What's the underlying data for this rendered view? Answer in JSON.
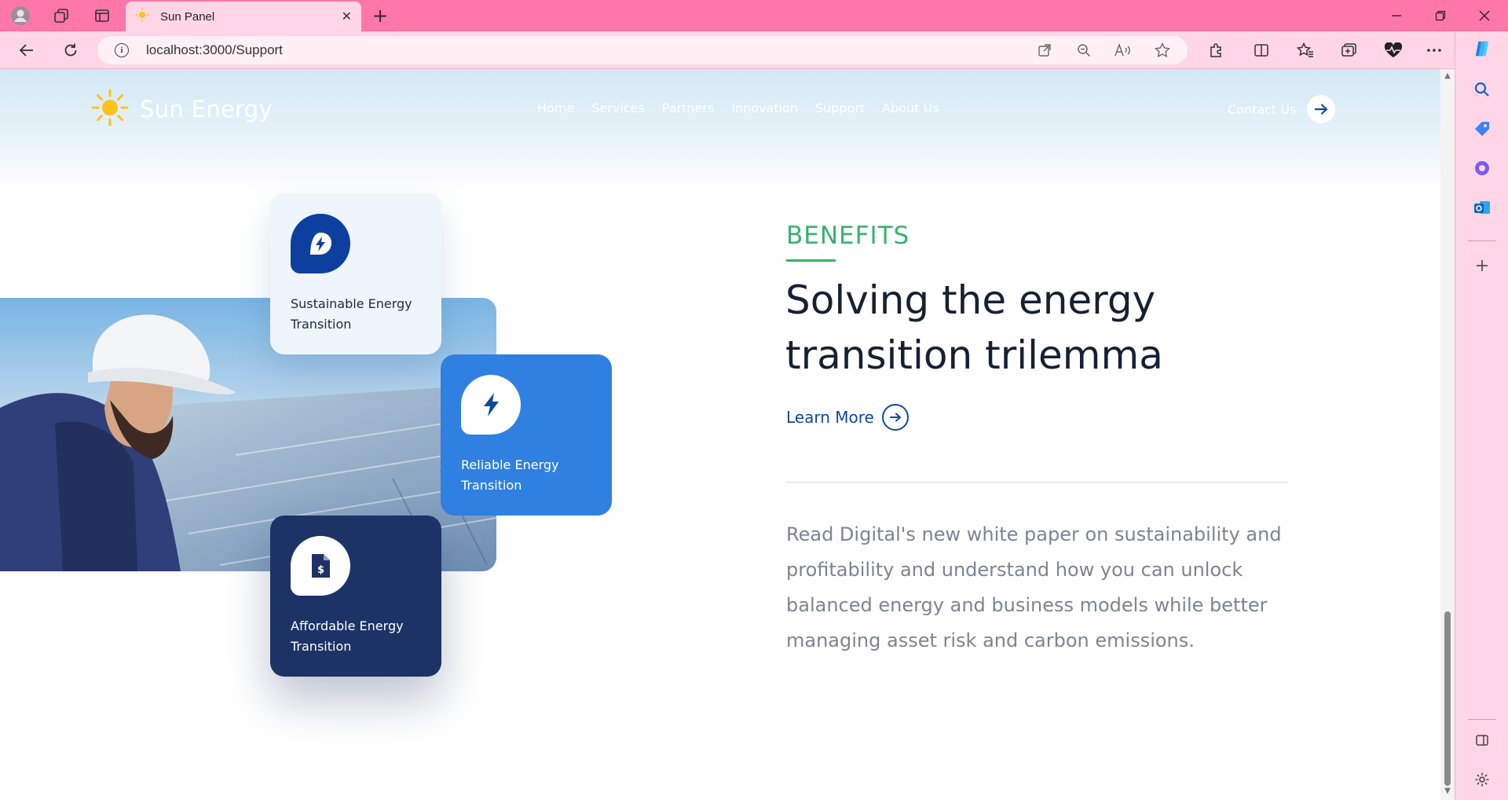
{
  "browser": {
    "tab_title": "Sun Panel",
    "url": "localhost:3000/Support"
  },
  "site": {
    "brand": "Sun Energy",
    "nav": [
      "Home",
      "Services",
      "Partners",
      "Innovation",
      "Support",
      "About Us"
    ],
    "contact_label": "Contact Us"
  },
  "cards": [
    {
      "title": "Sustainable Energy Transition",
      "icon": "leaf-bolt-icon"
    },
    {
      "title": "Reliable Energy Transition",
      "icon": "bolt-icon"
    },
    {
      "title": "Affordable Energy Transition",
      "icon": "dollar-document-icon"
    }
  ],
  "benefits": {
    "eyebrow": "BENEFITS",
    "headline": "Solving the energy transition trilemma",
    "learn_more": "Learn More",
    "body": "Read Digital's new white paper on sustainability and profitability and understand how you can unlock balanced energy and business models while better managing asset risk and carbon emissions."
  },
  "colors": {
    "accent_green": "#37b36c",
    "brand_blue": "#0f4a9a",
    "card_blue": "#2f80e0",
    "card_navy": "#1d3366",
    "chrome_pink": "#ff77a6"
  }
}
